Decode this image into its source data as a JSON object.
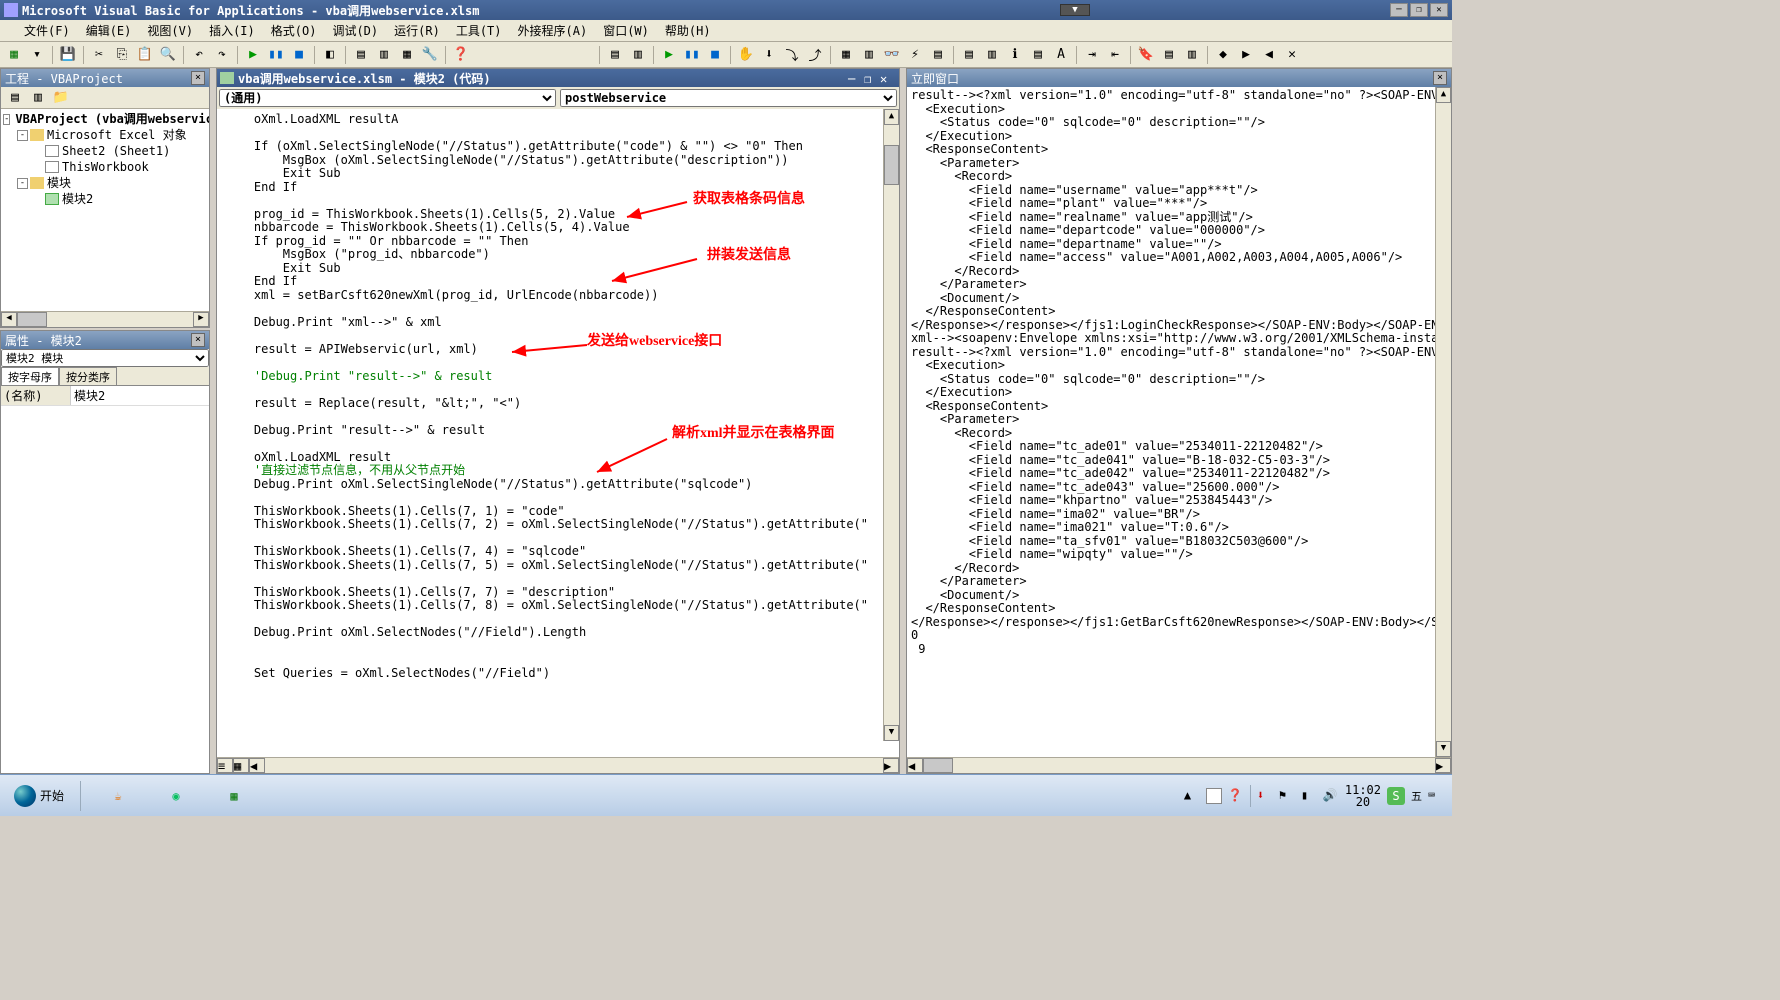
{
  "app": {
    "title": "Microsoft Visual Basic for Applications - vba调用webservice.xlsm"
  },
  "menu": {
    "file": "文件(F)",
    "edit": "编辑(E)",
    "view": "视图(V)",
    "insert": "插入(I)",
    "format": "格式(O)",
    "debug": "调试(D)",
    "run": "运行(R)",
    "tools": "工具(T)",
    "addins": "外接程序(A)",
    "window": "窗口(W)",
    "help": "帮助(H)"
  },
  "project_panel": {
    "title": "工程 - VBAProject",
    "root": "VBAProject (vba调用webservice.xlsm)",
    "excel_objects": "Microsoft Excel 对象",
    "sheet2": "Sheet2 (Sheet1)",
    "thiswb": "ThisWorkbook",
    "modules": "模块",
    "module2": "模块2"
  },
  "props_panel": {
    "title": "属性 - 模块2",
    "object_select": "模块2 模块",
    "tab_alpha": "按字母序",
    "tab_cat": "按分类序",
    "name_key": "(名称)",
    "name_val": "模块2"
  },
  "code_win": {
    "title": "vba调用webservice.xlsm - 模块2 (代码)",
    "left_combo": "(通用)",
    "right_combo": "postWebservice",
    "code": "    oXml.LoadXML resultA\n\n    If (oXml.SelectSingleNode(\"//Status\").getAttribute(\"code\") & \"\") <> \"0\" Then\n        MsgBox (oXml.SelectSingleNode(\"//Status\").getAttribute(\"description\"))\n        Exit Sub\n    End If\n\n    prog_id = ThisWorkbook.Sheets(1).Cells(5, 2).Value\n    nbbarcode = ThisWorkbook.Sheets(1).Cells(5, 4).Value\n    If prog_id = \"\" Or nbbarcode = \"\" Then\n        MsgBox (\"prog_id、nbbarcode\")\n        Exit Sub\n    End If\n    xml = setBarCsft620newXml(prog_id, UrlEncode(nbbarcode))\n\n    Debug.Print \"xml-->\" & xml\n\n    result = APIWebservic(url, xml)\n\n    'Debug.Print \"result-->\" & result\n\n    result = Replace(result, \"&lt;\", \"<\")\n\n    Debug.Print \"result-->\" & result\n\n    oXml.LoadXML result\n    '直接过滤节点信息，不用从父节点开始\n    Debug.Print oXml.SelectSingleNode(\"//Status\").getAttribute(\"sqlcode\")\n\n    ThisWorkbook.Sheets(1).Cells(7, 1) = \"code\"\n    ThisWorkbook.Sheets(1).Cells(7, 2) = oXml.SelectSingleNode(\"//Status\").getAttribute(\"\n\n    ThisWorkbook.Sheets(1).Cells(7, 4) = \"sqlcode\"\n    ThisWorkbook.Sheets(1).Cells(7, 5) = oXml.SelectSingleNode(\"//Status\").getAttribute(\"\n\n    ThisWorkbook.Sheets(1).Cells(7, 7) = \"description\"\n    ThisWorkbook.Sheets(1).Cells(7, 8) = oXml.SelectSingleNode(\"//Status\").getAttribute(\"\n\n    Debug.Print oXml.SelectNodes(\"//Field\").Length\n\n\n    Set Queries = oXml.SelectNodes(\"//Field\")",
    "annotations": {
      "a1": "获取表格条码信息",
      "a2": "拼装发送信息",
      "a3": "发送给webservice接口",
      "a4": "解析xml并显示在表格界面"
    }
  },
  "immediate": {
    "title": "立即窗口",
    "text": "result--><?xml version=\"1.0\" encoding=\"utf-8\" standalone=\"no\" ?><SOAP-ENV:En\n  <Execution>\n    <Status code=\"0\" sqlcode=\"0\" description=\"\"/>\n  </Execution>\n  <ResponseContent>\n    <Parameter>\n      <Record>\n        <Field name=\"username\" value=\"app***t\"/>\n        <Field name=\"plant\" value=\"***\"/>\n        <Field name=\"realname\" value=\"app测试\"/>\n        <Field name=\"departcode\" value=\"000000\"/>\n        <Field name=\"departname\" value=\"\"/>\n        <Field name=\"access\" value=\"A001,A002,A003,A004,A005,A006\"/>\n      </Record>\n    </Parameter>\n    <Document/>\n  </ResponseContent>\n</Response></response></fjs1:LoginCheckResponse></SOAP-ENV:Body></SOAP-ENV:E\nxml--><soapenv:Envelope xmlns:xsi=\"http://www.w3.org/2001/XMLSchema-instance\nresult--><?xml version=\"1.0\" encoding=\"utf-8\" standalone=\"no\" ?><SOAP-ENV:En\n  <Execution>\n    <Status code=\"0\" sqlcode=\"0\" description=\"\"/>\n  </Execution>\n  <ResponseContent>\n    <Parameter>\n      <Record>\n        <Field name=\"tc_ade01\" value=\"2534011-22120482\"/>\n        <Field name=\"tc_ade041\" value=\"B-18-032-C5-03-3\"/>\n        <Field name=\"tc_ade042\" value=\"2534011-22120482\"/>\n        <Field name=\"tc_ade043\" value=\"25600.000\"/>\n        <Field name=\"khpartno\" value=\"253845443\"/>\n        <Field name=\"ima02\" value=\"BR\"/>\n        <Field name=\"ima021\" value=\"T:0.6\"/>\n        <Field name=\"ta_sfv01\" value=\"B18032C503@600\"/>\n        <Field name=\"wipqty\" value=\"\"/>\n      </Record>\n    </Parameter>\n    <Document/>\n  </ResponseContent>\n</Response></response></fjs1:GetBarCsft620newResponse></SOAP-ENV:Body></SOAP\n0\n 9"
  },
  "taskbar": {
    "start": "开始",
    "clock_time": "11:02",
    "clock_extra": "20",
    "ime": "五"
  }
}
